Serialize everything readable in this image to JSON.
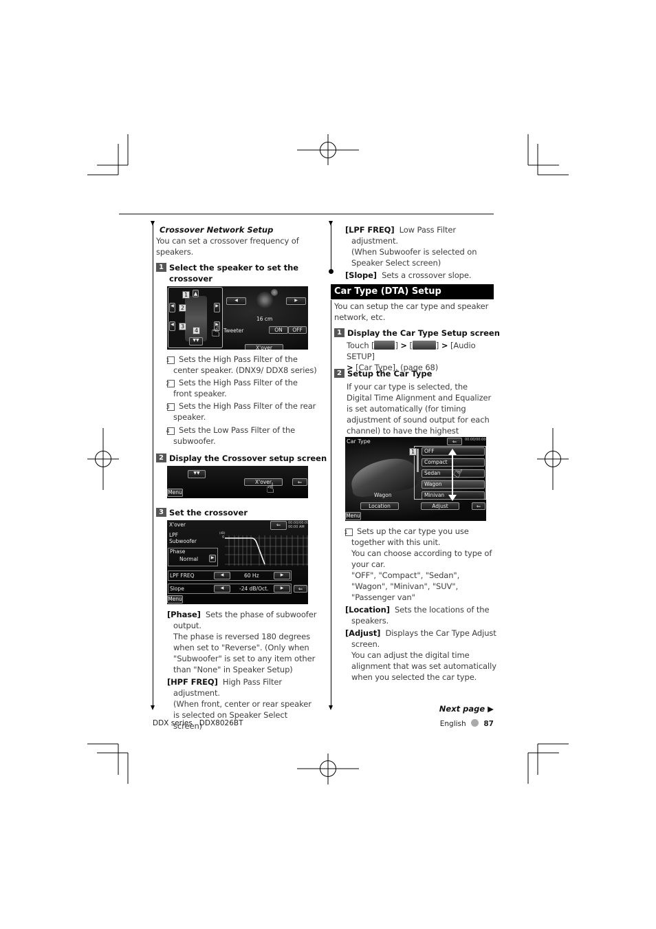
{
  "left_column": {
    "heading": "Crossover Network Setup",
    "intro": "You can set a crossover frequency of speakers.",
    "step1": {
      "num": "1",
      "title": "Select the speaker to set the crossover"
    },
    "speaker_screen": {
      "labels": [
        "1",
        "2",
        "3",
        "4"
      ],
      "size_value": "16 cm",
      "tweeter_label": "Tweeter",
      "on_label": "ON",
      "off_label": "OFF",
      "xover_label": "X'over"
    },
    "callouts": [
      {
        "num": "1",
        "text": "Sets the High Pass Filter of the center speaker. (DNX9/ DDX8 series)"
      },
      {
        "num": "2",
        "text": "Sets the High Pass Filter of the front speaker."
      },
      {
        "num": "3",
        "text": "Sets the High Pass Filter of the rear speaker."
      },
      {
        "num": "4",
        "text": "Sets the Low Pass Filter of the subwoofer."
      }
    ],
    "step2": {
      "num": "2",
      "title": "Display the Crossover setup screen"
    },
    "xover_button_screen": {
      "xover_label": "X'over",
      "menu_label": "Menu"
    },
    "step3": {
      "num": "3",
      "title": "Set the crossover"
    },
    "crossover_screen": {
      "title": "X'over",
      "clock": "00:00/00:00 00:00 AM",
      "lpf_label": "LPF",
      "subwoofer_label": "Subwoofer",
      "phase_label": "Phase",
      "phase_value": "Normal",
      "lpf_freq_label": "LPF FREQ",
      "lpf_freq_value": "60 Hz",
      "slope_label": "Slope",
      "slope_value": "-24 dB/Oct.",
      "menu_label": "Menu",
      "graph_top_label": "0",
      "graph_unit_label": "(dB)"
    },
    "defs": [
      {
        "term": "[Phase]",
        "text": "Sets the phase of subwoofer output.",
        "extra": "The phase is reversed 180 degrees when set to \"Reverse\". (Only when \"Subwoofer\" is set to any item other than \"None\" in Speaker Setup)"
      },
      {
        "term": "[HPF FREQ]",
        "text": "High Pass Filter adjustment.",
        "extra": "(When front, center or rear speaker is selected on Speaker Select screen)"
      }
    ]
  },
  "right_column": {
    "defs": [
      {
        "term": "[LPF FREQ]",
        "text": "Low Pass Filter adjustment.",
        "extra": "(When Subwoofer is selected on Speaker Select screen)"
      },
      {
        "term": "[Slope]",
        "text": "Sets a crossover slope."
      }
    ],
    "section_title": "Car Type (DTA) Setup",
    "section_intro": "You can setup the car type and speaker network, etc.",
    "step1": {
      "num": "1",
      "title": "Display the Car Type Setup screen",
      "touch_prefix": "Touch [",
      "bracket_close": "]",
      "audio_setup": "[Audio SETUP]",
      "car_type_ref": "[Car Type]. (page 68)"
    },
    "step2": {
      "num": "2",
      "title": "Setup the Car Type",
      "text": "If your car type is selected, the Digital Time Alignment and Equalizer is set automatically (for timing adjustment of sound output for each channel) to have the highest surround effects."
    },
    "car_type_screen": {
      "title": "Car Type",
      "clock": "00:00/00:00",
      "callout_num": "1",
      "options": [
        "OFF",
        "Compact",
        "Sedan",
        "Wagon",
        "Minivan"
      ],
      "selected": "Wagon",
      "car_label": "Wagon",
      "location_label": "Location",
      "adjust_label": "Adjust",
      "menu_label": "Menu"
    },
    "callout": {
      "num": "1",
      "text": "Sets up the car type you use together with this unit.",
      "extra1": "You can choose according to type of your car.",
      "extra2": "\"OFF\", \"Compact\", \"Sedan\", \"Wagon\", \"Minivan\", \"SUV\", \"Passenger van\""
    },
    "defs2": [
      {
        "term": "[Location]",
        "text": "Sets the locations of the speakers."
      },
      {
        "term": "[Adjust]",
        "text": "Displays the Car Type Adjust screen.",
        "extra": "You can adjust the digital time alignment that was set automatically when you selected the car type."
      }
    ]
  },
  "footer": {
    "next_page": "Next page ▶",
    "series": "DDX series   DDX8026BT",
    "language": "English",
    "page_number": "87"
  }
}
